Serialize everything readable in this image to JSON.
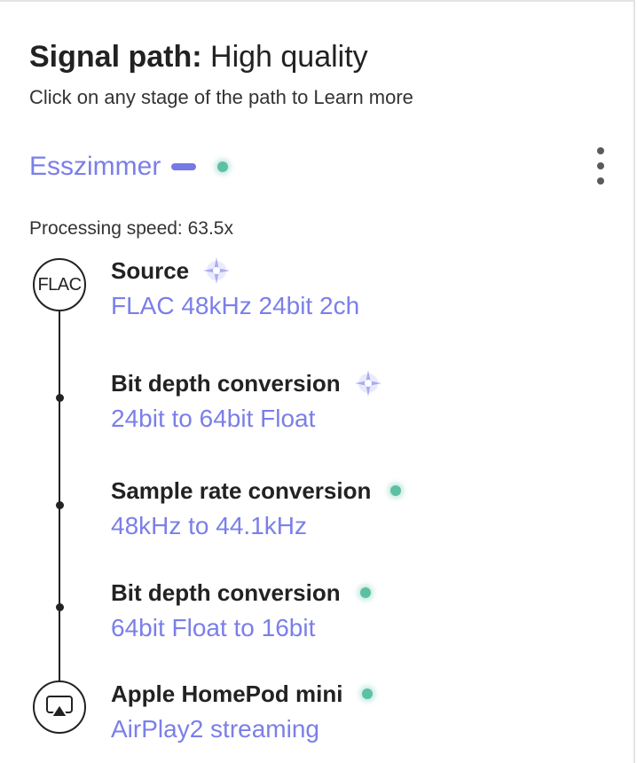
{
  "header": {
    "title_bold": "Signal path:",
    "title_quality": "High quality",
    "subtitle": "Click on any stage of the path to Learn more"
  },
  "zone": {
    "name": "Esszimmer"
  },
  "processing": {
    "label": "Processing speed: 63.5x"
  },
  "source_node": {
    "badge": "FLAC"
  },
  "stages": [
    {
      "title": "Source",
      "detail": "FLAC 48kHz 24bit 2ch",
      "quality_icon": "sparkle-icon"
    },
    {
      "title": "Bit depth conversion",
      "detail": "24bit to 64bit Float",
      "quality_icon": "sparkle-icon"
    },
    {
      "title": "Sample rate conversion",
      "detail": "48kHz to 44.1kHz",
      "quality_icon": "quality-dot-icon"
    },
    {
      "title": "Bit depth conversion",
      "detail": "64bit Float to 16bit",
      "quality_icon": "quality-dot-icon"
    },
    {
      "title": "Apple HomePod mini",
      "detail": "AirPlay2 streaming",
      "quality_icon": "quality-dot-icon"
    }
  ],
  "colors": {
    "accent": "#7b7fe8",
    "quality_dot": "#5cc0a3",
    "sparkle": "#a9abf2",
    "text": "#222222"
  }
}
